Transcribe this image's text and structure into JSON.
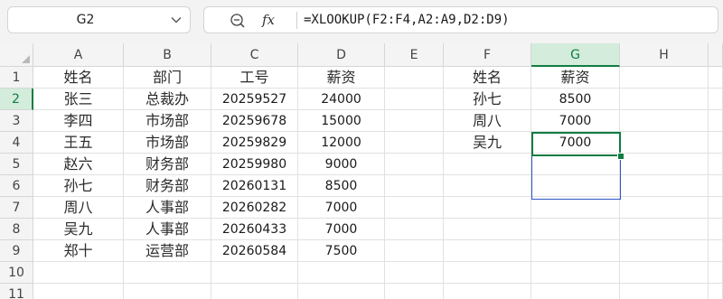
{
  "name_box": {
    "value": "G2"
  },
  "formula_bar": {
    "fx_label": "fx",
    "formula": "=XLOOKUP(F2:F4,A2:A9,D2:D9)"
  },
  "columns": [
    "A",
    "B",
    "C",
    "D",
    "E",
    "F",
    "G",
    "H"
  ],
  "rows": [
    "1",
    "2",
    "3",
    "4",
    "5",
    "6",
    "7",
    "8",
    "9",
    "10",
    "11"
  ],
  "selection": {
    "active_cell": "G2",
    "active_column": "G",
    "active_row": "2",
    "reference_range": "G2:G4"
  },
  "cells": {
    "A1": "姓名",
    "B1": "部门",
    "C1": "工号",
    "D1": "薪资",
    "A2": "张三",
    "B2": "总裁办",
    "C2": "20259527",
    "D2": "24000",
    "A3": "李四",
    "B3": "市场部",
    "C3": "20259678",
    "D3": "15000",
    "A4": "王五",
    "B4": "市场部",
    "C4": "20259829",
    "D4": "12000",
    "A5": "赵六",
    "B5": "财务部",
    "C5": "20259980",
    "D5": "9000",
    "A6": "孙七",
    "B6": "财务部",
    "C6": "20260131",
    "D6": "8500",
    "A7": "周八",
    "B7": "人事部",
    "C7": "20260282",
    "D7": "7000",
    "A8": "吴九",
    "B8": "人事部",
    "C8": "20260433",
    "D8": "7000",
    "A9": "郑十",
    "B9": "运营部",
    "C9": "20260584",
    "D9": "7500",
    "F1": "姓名",
    "G1": "薪资",
    "F2": "孙七",
    "G2": "8500",
    "F3": "周八",
    "G3": "7000",
    "F4": "吴九",
    "G4": "7000"
  },
  "icons": {
    "name_box_dropdown": "chevron-down-icon",
    "zoom": "zoom-icon",
    "function": "fx-icon"
  },
  "colors": {
    "selection_green": "#107c41",
    "reference_blue": "#2f56c6",
    "header_selected_bg": "#d3ecdb"
  }
}
